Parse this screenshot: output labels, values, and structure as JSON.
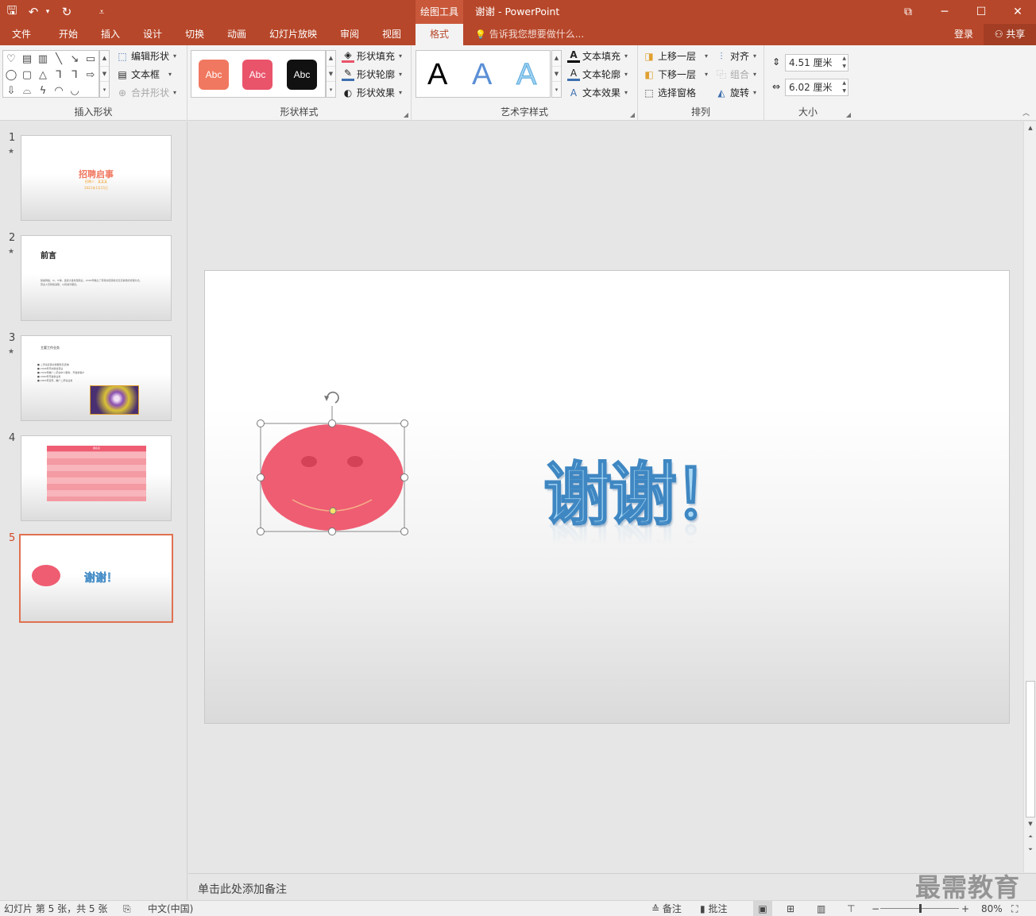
{
  "titlebar": {
    "context_tab": "绘图工具",
    "doc_title": "谢谢 - PowerPoint",
    "qat": {
      "save_icon": "🖫",
      "undo_icon": "↶",
      "undo_caret": "▾",
      "redo_icon": "↻",
      "customize_icon": "⩡"
    },
    "window": {
      "restore_ribbon_icon": "⧉",
      "minimize_icon": "─",
      "maximize_icon": "☐",
      "close_icon": "✕"
    }
  },
  "tabs": [
    {
      "label": "文件"
    },
    {
      "label": "开始"
    },
    {
      "label": "插入"
    },
    {
      "label": "设计"
    },
    {
      "label": "切换"
    },
    {
      "label": "动画"
    },
    {
      "label": "幻灯片放映"
    },
    {
      "label": "审阅"
    },
    {
      "label": "视图"
    },
    {
      "label": "格式"
    }
  ],
  "tell_me": {
    "icon": "💡",
    "text": "告诉我您想要做什么..."
  },
  "account": {
    "login": "登录",
    "share": "共享",
    "share_icon": "⚇"
  },
  "ribbon": {
    "insert_shapes": {
      "label": "插入形状",
      "shapes": [
        "♡",
        "▤",
        "▥",
        "╲",
        "↘",
        "▭",
        "◯",
        "▢",
        "△",
        "⅂",
        "⅂",
        "⇨",
        "⇩",
        "⌓",
        "ϟ",
        "◠",
        "◡",
        ""
      ],
      "edit_shape": "编辑形状",
      "text_box": "文本框",
      "merge_shapes": "合并形状"
    },
    "shape_styles": {
      "label": "形状样式",
      "swatches": [
        {
          "text": "Abc",
          "color": "#f07860"
        },
        {
          "text": "Abc",
          "color": "#e9546b"
        },
        {
          "text": "Abc",
          "color": "#111111"
        }
      ],
      "fill": "形状填充",
      "outline": "形状轮廓",
      "effects": "形状效果"
    },
    "wordart": {
      "label": "艺术字样式",
      "samples": [
        {
          "text": "A",
          "color": "#000000"
        },
        {
          "text": "A",
          "color": "#5b8fd6"
        },
        {
          "text": "A",
          "color": "#9fd3f2"
        }
      ],
      "text_fill": "文本填充",
      "text_outline": "文本轮廓",
      "text_effects": "文本效果"
    },
    "arrange": {
      "label": "排列",
      "bring_forward": "上移一层",
      "send_backward": "下移一层",
      "selection_pane": "选择窗格",
      "align": "对齐",
      "group": "组合",
      "rotate": "旋转"
    },
    "size": {
      "label": "大小",
      "height": "4.51 厘米",
      "width": "6.02 厘米"
    }
  },
  "slides": [
    {
      "num": "1",
      "star": "★",
      "title": "招聘启事",
      "sub1": "招聘人：某某某",
      "sub2": "2021年1月15日"
    },
    {
      "num": "2",
      "star": "★",
      "title": "前言",
      "line1": "随着网络、IC、IT等，造就大批新型职业，2018年确立了现有的经营模式及高素质的管理方式。",
      "line2": "营业人员积极进取，以真诚为理念。"
    },
    {
      "num": "3",
      "star": "★",
      "title": "主要工作业务",
      "bullets": [
        "二手房买卖交易服务及咨询",
        "2018年开办联合营业",
        "2019年推广二手房中介服务，开发新客户",
        "2020年开发新业务",
        "2021年宣传，推广二手房业务"
      ]
    },
    {
      "num": "4",
      "star": "",
      "table_title": "报名表"
    },
    {
      "num": "5",
      "star": "",
      "text": "谢谢！"
    }
  ],
  "slide_main": {
    "wordart_text": "谢谢！",
    "face_color": "#ef5d72",
    "eye_color": "#d44257",
    "smile_color": "#f5b08a"
  },
  "notes": {
    "placeholder": "单击此处添加备注"
  },
  "watermark": "最需教育",
  "statusbar": {
    "slide_info": "幻灯片 第 5 张，共 5 张",
    "language": "中文(中国)",
    "notes_btn": "备注",
    "comments_btn": "批注",
    "zoom": "80%",
    "zoom_fraction": 0.5
  }
}
